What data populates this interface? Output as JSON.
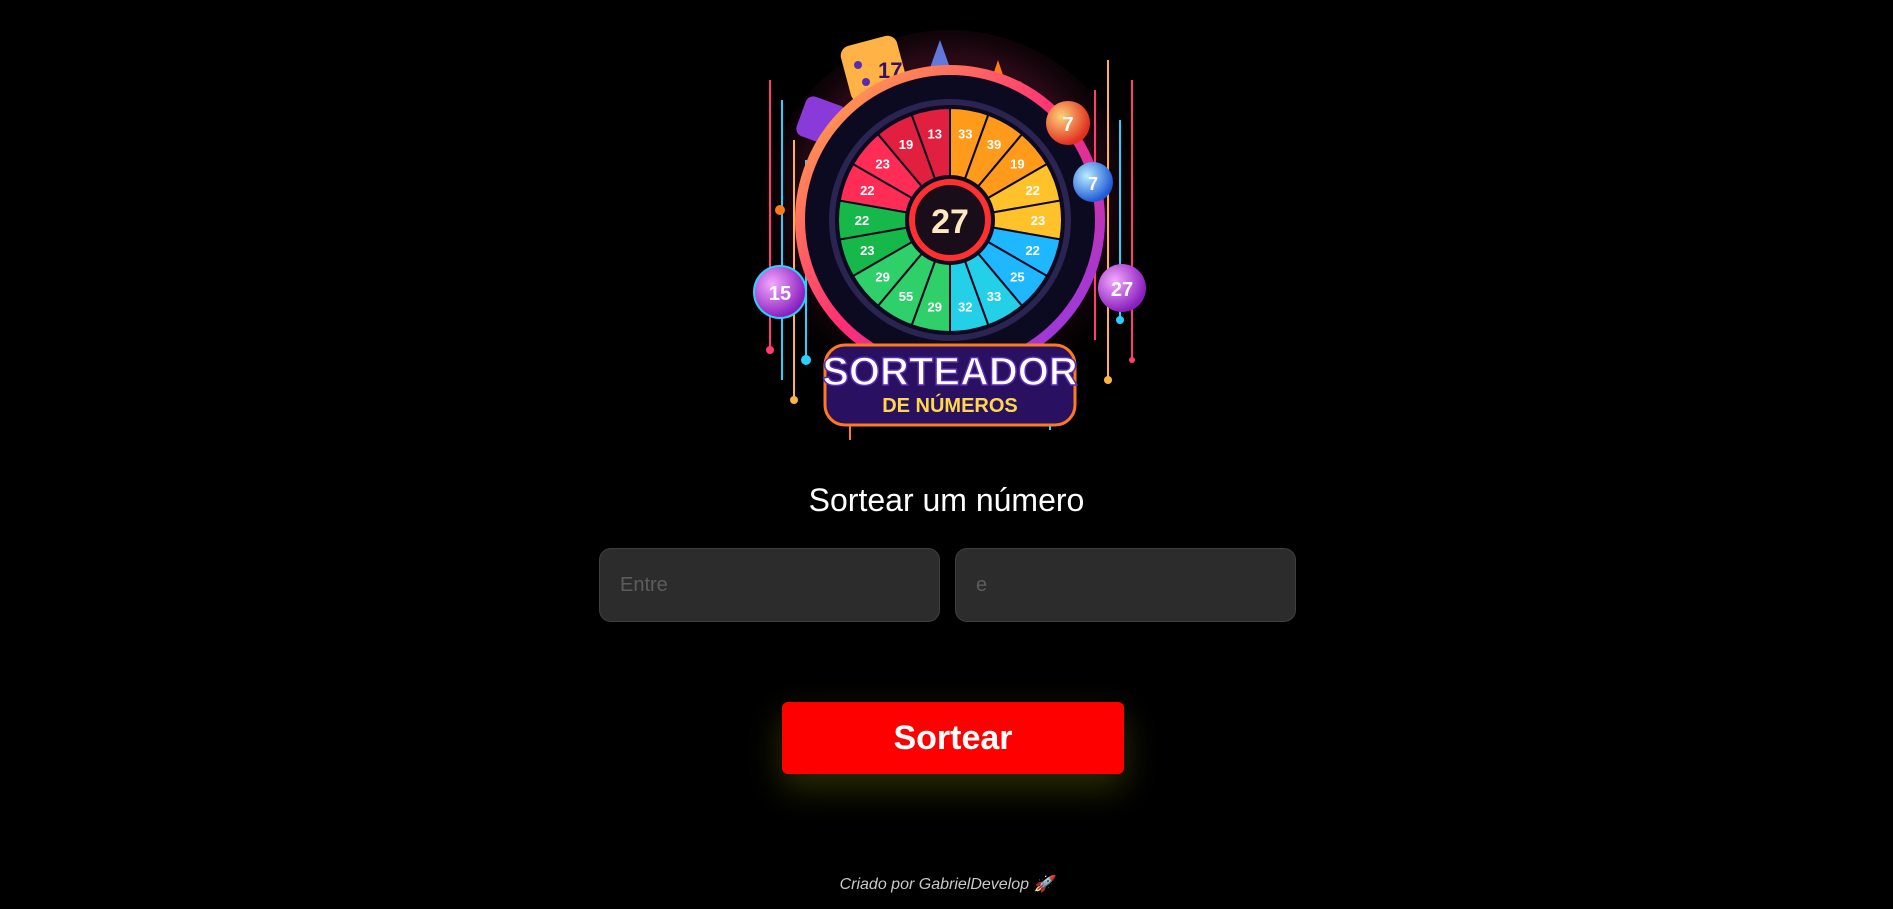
{
  "logo": {
    "title": "SORTEADOR",
    "subtitle": "DE NÚMEROS",
    "center_number": "27",
    "ball_left": "15",
    "ball_right": "27",
    "ball_top": "7",
    "ball_mid": "7",
    "dice_face": "17",
    "wheel_numbers": [
      "33",
      "39",
      "19",
      "22",
      "23",
      "22",
      "25",
      "33",
      "32",
      "29",
      "55",
      "29",
      "23",
      "22",
      "22",
      "23",
      "19",
      "13"
    ]
  },
  "title": "Sortear um número",
  "inputs": {
    "from_placeholder": "Entre",
    "from_value": "",
    "to_placeholder": "e",
    "to_value": ""
  },
  "draw_button": "Sortear",
  "footer": "Criado por GabrielDevelop 🚀",
  "colors": {
    "background": "#000000",
    "button": "#ff0000",
    "input": "#2c2c2c"
  }
}
